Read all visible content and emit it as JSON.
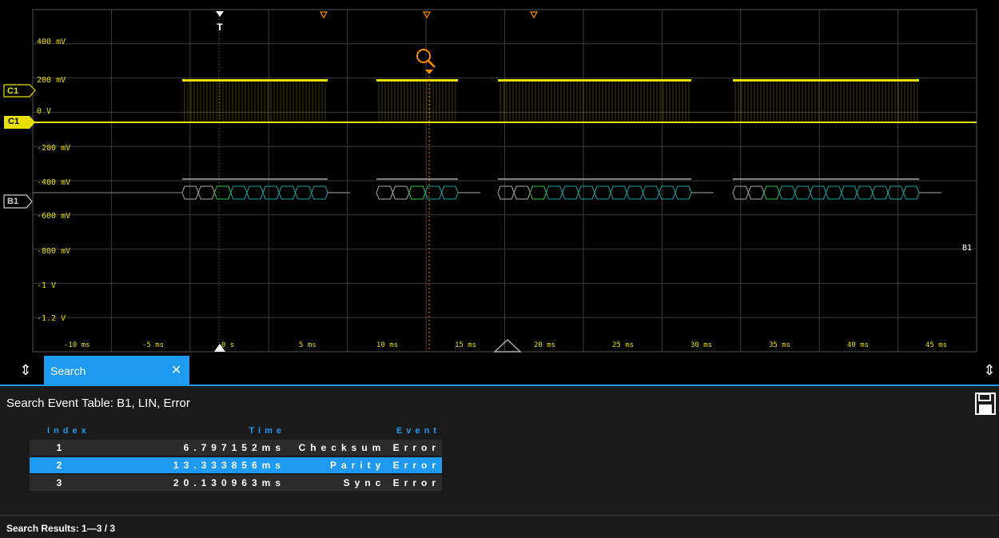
{
  "waveform": {
    "y_labels": [
      "400 mV",
      "200 mV",
      "0 V",
      "-200 mV",
      "-400 mV",
      "-600 mV",
      "-800 mV",
      "-1 V",
      "-1.2 V"
    ],
    "x_labels": [
      "-10 ms",
      "-5 ms",
      "0 s",
      "5 ms",
      "10 ms",
      "15 ms",
      "20 ms",
      "25 ms",
      "30 ms",
      "35 ms",
      "40 ms",
      "45 ms"
    ],
    "channel_labels": {
      "c1_small": "C1",
      "c1": "C1",
      "b1": "B1"
    },
    "b1_side_label": "B1",
    "trigger_label": "T",
    "colors": {
      "c1": "#e8e000",
      "grid": "#3a3a3a",
      "cursor": "#ff8c00",
      "selected": "#1e9bf0"
    }
  },
  "tab": {
    "label": "Search",
    "close_icon": "close-icon"
  },
  "panel": {
    "title": "Search Event Table: B1, LIN, Error",
    "table": {
      "headers": {
        "index": "Index",
        "time": "Time",
        "event": "Event"
      },
      "rows": [
        {
          "index": "1",
          "time": "6.797152ms",
          "event": "Checksum Error"
        },
        {
          "index": "2",
          "time": "13.333856ms",
          "event": "Parity Error"
        },
        {
          "index": "3",
          "time": "20.130963ms",
          "event": "Sync Error"
        }
      ],
      "selected_row": 2
    },
    "status": "Search Results:  1—3 / 3"
  }
}
